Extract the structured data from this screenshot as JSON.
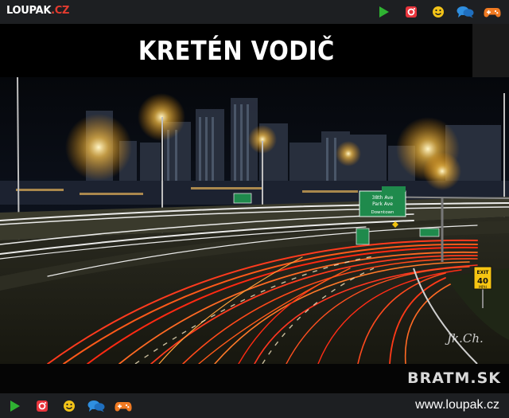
{
  "brand": {
    "logo_main": "LOUPAK",
    "logo_suffix": ".CZ"
  },
  "post": {
    "title": "KRETÉN VODIČ"
  },
  "image": {
    "signs": {
      "overhead_line1": "38th Ave",
      "overhead_line2": "Park Ave",
      "overhead_line3": "Downtown",
      "exit_top": "EXIT",
      "exit_number": "40",
      "exit_unit": "MPH"
    },
    "signature": "Jk.Ch."
  },
  "watermark": "BRATM.SK",
  "footer": {
    "url": "www.loupak.cz"
  },
  "icons": [
    "play-icon",
    "instagram-icon",
    "smiley-icon",
    "chat-icon",
    "gamepad-icon"
  ],
  "colors": {
    "play": "#2fb232",
    "instagram": "#e8343c",
    "smiley": "#f2c318",
    "chat": "#2f8fe0",
    "gamepad": "#f07a22"
  }
}
